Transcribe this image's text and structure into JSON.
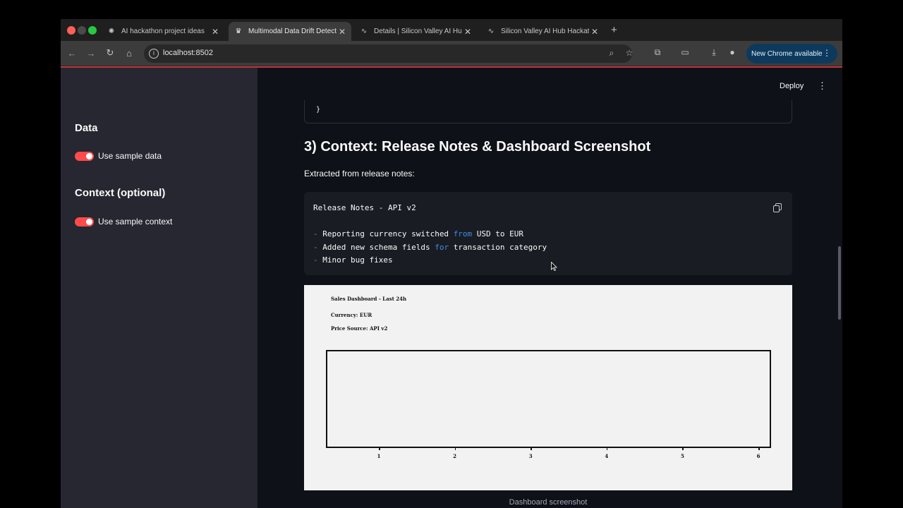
{
  "browser": {
    "tabs": [
      {
        "title": "AI hackathon project ideas",
        "active": false,
        "icon": "openai-icon"
      },
      {
        "title": "Multimodal Data Drift Detector",
        "active": true,
        "icon": "streamlit-icon"
      },
      {
        "title": "Details | Silicon Valley AI Hub",
        "active": false,
        "icon": "pulse-icon"
      },
      {
        "title": "Silicon Valley AI Hub Hackathon",
        "active": false,
        "icon": "pulse-icon"
      }
    ],
    "new_tab_label": "+",
    "url": "localhost:8502",
    "update_label": "New Chrome available",
    "accent_color": "#c2343a"
  },
  "sidebar": {
    "data_heading": "Data",
    "use_sample_data_label": "Use sample data",
    "use_sample_data_on": true,
    "context_heading": "Context (optional)",
    "use_sample_context_label": "Use sample context",
    "use_sample_context_on": true,
    "toggle_color": "#ff4b4b"
  },
  "main": {
    "deploy_label": "Deploy",
    "code_closing": "}",
    "section_title": "3) Context: Release Notes & Dashboard Screenshot",
    "extracted_label": "Extracted from release notes:",
    "release_notes": {
      "title_line": "Release Notes - API v2",
      "line1_pre": "Reporting currency switched ",
      "line1_kw": "from",
      "line1_post": " USD to EUR",
      "line2_pre": "Added new schema fields ",
      "line2_kw": "for",
      "line2_post": " transaction category",
      "line3": "Minor bug fixes"
    },
    "screenshot": {
      "title": "Sales Dashboard - Last 24h",
      "currency": "Currency: EUR",
      "price_source": "Price Source: API v2",
      "x_ticks": [
        "1",
        "2",
        "3",
        "4",
        "5",
        "6"
      ],
      "caption": "Dashboard screenshot"
    }
  }
}
